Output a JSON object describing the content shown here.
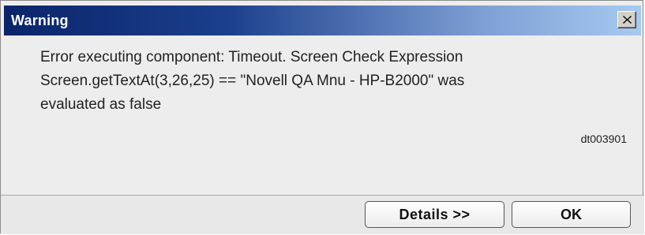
{
  "dialog": {
    "title": "Warning",
    "close_symbol": "X",
    "message_lines": [
      "Error executing component: Timeout. Screen Check Expression",
      "Screen.getTextAt(3,26,25) == \"Novell QA Mnu - HP-B2000\" was",
      "evaluated as false"
    ],
    "code": "dt003901",
    "buttons": {
      "details_label": "Details >>",
      "ok_label": "OK"
    }
  },
  "colors": {
    "titlebar_start": "#0a246a",
    "titlebar_end": "#a6caf0",
    "background": "#ededed"
  },
  "icons": {
    "close": "close-icon"
  }
}
